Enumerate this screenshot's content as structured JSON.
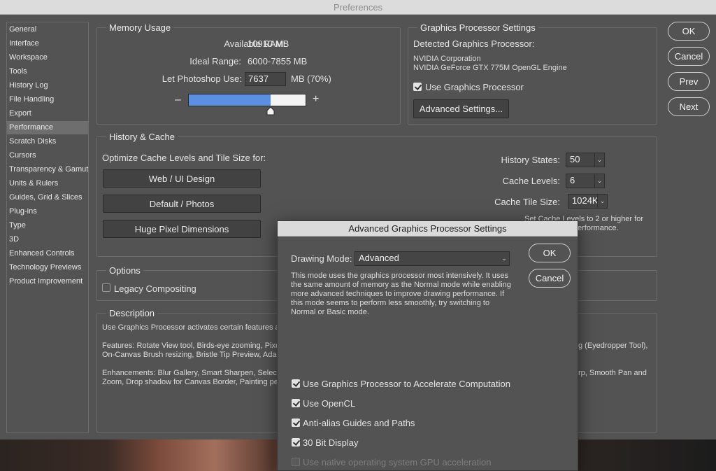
{
  "window": {
    "title": "Preferences"
  },
  "sidebar": {
    "items": [
      {
        "label": "General"
      },
      {
        "label": "Interface"
      },
      {
        "label": "Workspace"
      },
      {
        "label": "Tools"
      },
      {
        "label": "History Log"
      },
      {
        "label": "File Handling"
      },
      {
        "label": "Export"
      },
      {
        "label": "Performance",
        "selected": true
      },
      {
        "label": "Scratch Disks"
      },
      {
        "label": "Cursors"
      },
      {
        "label": "Transparency & Gamut"
      },
      {
        "label": "Units & Rulers"
      },
      {
        "label": "Guides, Grid & Slices"
      },
      {
        "label": "Plug-ins"
      },
      {
        "label": "Type"
      },
      {
        "label": "3D"
      },
      {
        "label": "Enhanced Controls"
      },
      {
        "label": "Technology Previews"
      },
      {
        "label": "Product Improvement"
      }
    ]
  },
  "memory": {
    "title": "Memory Usage",
    "available_label": "Available RAM:",
    "available_value": "10910 MB",
    "ideal_label": "Ideal Range:",
    "ideal_value": "6000-7855 MB",
    "let_label": "Let Photoshop Use:",
    "let_value": "7637",
    "let_suffix": "MB (70%)",
    "minus": "–",
    "plus": "+",
    "slider_fraction": 0.7
  },
  "gpu": {
    "title": "Graphics Processor Settings",
    "detected_label": "Detected Graphics Processor:",
    "vendor": "NVIDIA Corporation",
    "model": "NVIDIA GeForce GTX 775M OpenGL Engine",
    "use_label": "Use Graphics Processor",
    "use_checked": true,
    "advanced_button": "Advanced Settings..."
  },
  "buttons": {
    "ok": "OK",
    "cancel": "Cancel",
    "prev": "Prev",
    "next": "Next"
  },
  "history": {
    "title": "History & Cache",
    "optimize_label": "Optimize Cache Levels and Tile Size for:",
    "preset_web": "Web / UI Design",
    "preset_default": "Default / Photos",
    "preset_huge": "Huge Pixel Dimensions",
    "states_label": "History States:",
    "states_value": "50",
    "levels_label": "Cache Levels:",
    "levels_value": "6",
    "tile_label": "Cache Tile Size:",
    "tile_value": "1024K",
    "hint_line1": "Set Cache Levels to 2 or higher for",
    "hint_line2": "erformance."
  },
  "options": {
    "title": "Options",
    "legacy_label": "Legacy Compositing",
    "legacy_checked": false
  },
  "description": {
    "title": "Description",
    "line1": "Use Graphics Processor activates certain features a",
    "features1": "Features: Rotate View tool, Birds-eye zooming, Pixe",
    "features1_right": "g (Eyedropper Tool),",
    "features2": "On-Canvas Brush resizing, Bristle Tip Preview, Adap",
    "enh1": "Enhancements: Blur Gallery, Smart Sharpen, Select",
    "enh1_right": "rp, Smooth Pan and",
    "enh2": "Zoom, Drop shadow for Canvas Border, Painting per"
  },
  "dialog": {
    "title": "Advanced Graphics Processor Settings",
    "mode_label": "Drawing Mode:",
    "mode_value": "Advanced",
    "desc1": "This mode uses the graphics processor most intensively.  It uses",
    "desc2": "the same amount of memory as the Normal mode while enabling",
    "desc3": "more advanced techniques to improve drawing performance.  If",
    "desc4": "this mode seems to perform less smoothly, try switching to",
    "desc5": "Normal or Basic mode.",
    "ok": "OK",
    "cancel": "Cancel",
    "opt_compute": "Use Graphics Processor to Accelerate Computation",
    "opt_opencl": "Use OpenCL",
    "opt_antialias": "Anti-alias Guides and Paths",
    "opt_30bit": "30 Bit Display",
    "opt_native": "Use native operating system GPU acceleration"
  }
}
